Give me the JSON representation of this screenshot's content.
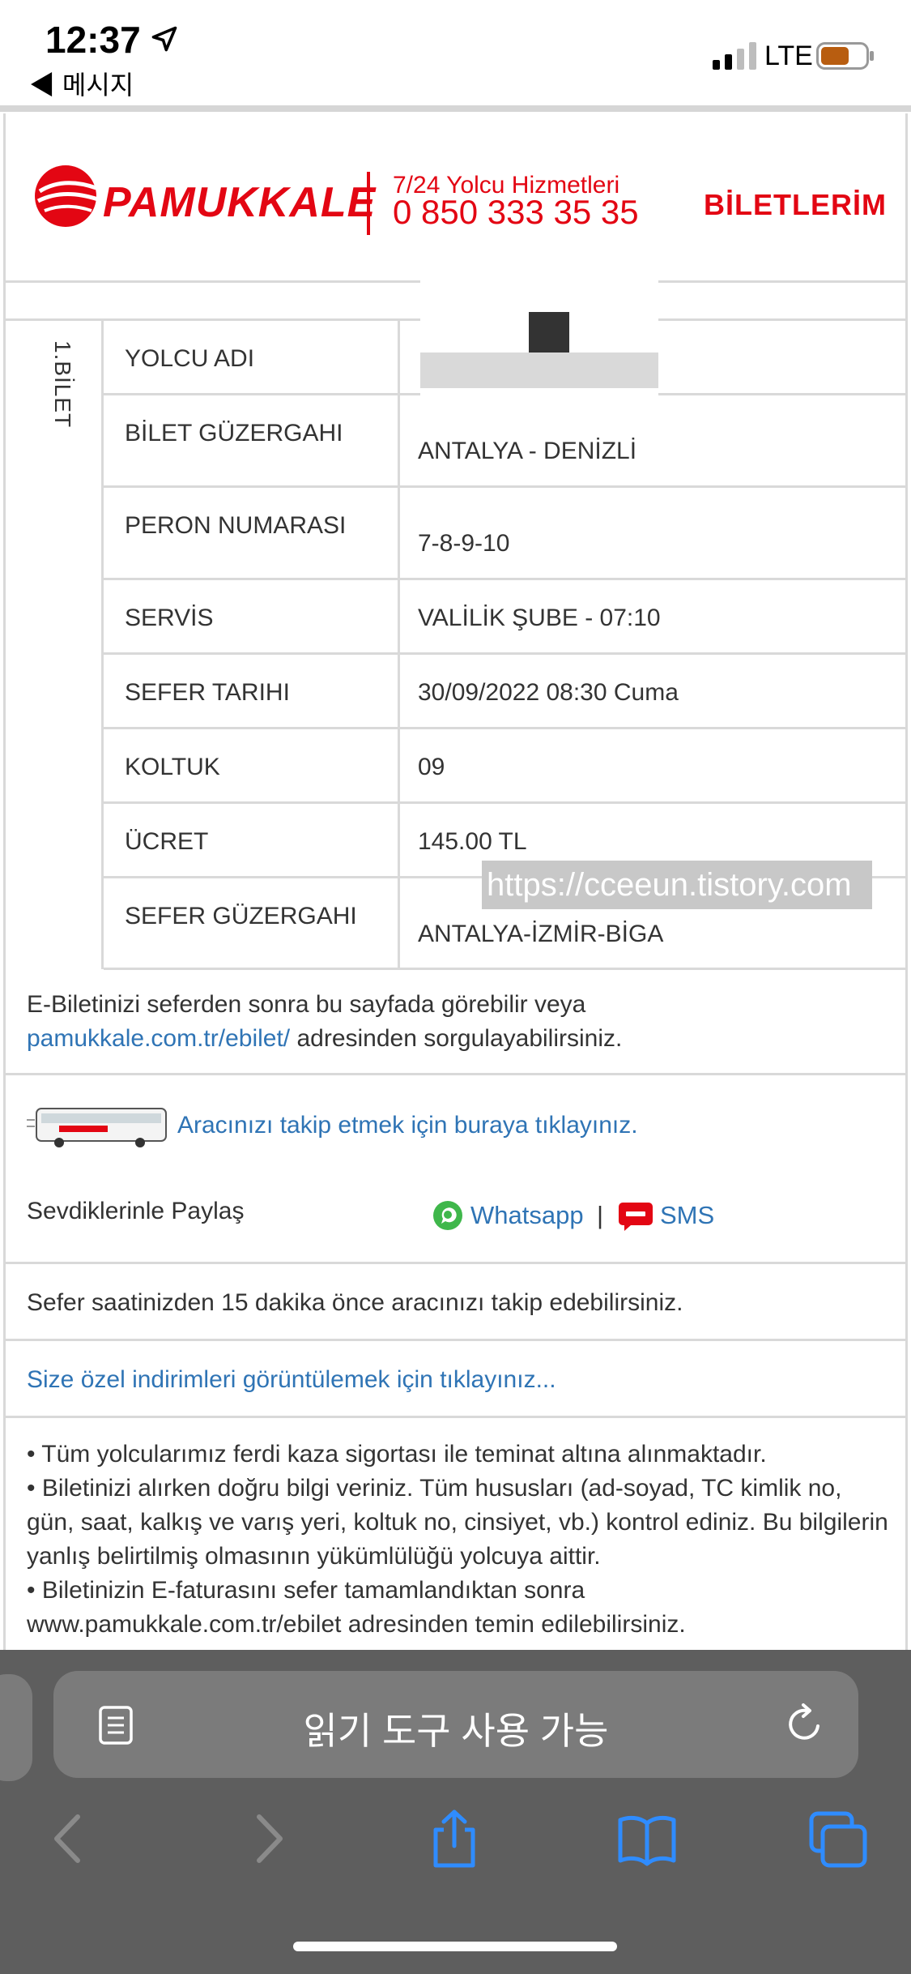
{
  "status_bar": {
    "time": "12:37",
    "back_label": "◀ 메시지",
    "network": "LTE"
  },
  "header": {
    "brand": "PAMUKKALE",
    "service_label": "7/24 Yolcu Hizmetleri",
    "service_phone": "0 850 333 35 35",
    "my_tickets": "BİLETLERİM"
  },
  "ticket": {
    "number_label": "1.BİLET",
    "rows": [
      {
        "label": "YOLCU ADI",
        "value": ""
      },
      {
        "label": "BİLET GÜZERGAHI",
        "value": "ANTALYA - DENİZLİ"
      },
      {
        "label": "PERON NUMARASI",
        "value": "7-8-9-10"
      },
      {
        "label": "SERVİS",
        "value": "VALİLİK ŞUBE - 07:10"
      },
      {
        "label": "SEFER TARIHI",
        "value": "30/09/2022 08:30 Cuma"
      },
      {
        "label": "KOLTUK",
        "value": "09"
      },
      {
        "label": "ÜCRET",
        "value": "145.00 TL"
      },
      {
        "label": "SEFER GÜZERGAHI",
        "value": "ANTALYA-İZMİR-BİGA"
      }
    ],
    "watermark": "https://cceeun.tistory.com"
  },
  "notes": {
    "ebilet_line1": "E-Biletinizi seferden sonra bu sayfada görebilir veya",
    "ebilet_link": "pamukkale.com.tr/ebilet/",
    "ebilet_line2_rest": " adresinden sorgulayabilirsiniz.",
    "track_link": "Aracınızı takip etmek için buraya tıklayınız.",
    "share_label": "Sevdiklerinle Paylaş",
    "whatsapp": "Whatsapp",
    "separator": "|",
    "sms": "SMS",
    "track_info": "Sefer saatinizden 15 dakika önce aracınızı takip edebilirsiniz.",
    "discount_link": "Size özel indirimleri görüntülemek için tıklayınız...",
    "bullets": [
      "• Tüm yolcularımız ferdi kaza sigortası ile teminat altına alınmaktadır.",
      "• Biletinizi alırken doğru bilgi veriniz. Tüm hususları (ad-soyad, TC kimlik no, gün, saat, kalkış ve varış yeri, koltuk no, cinsiyet, vb.) kontrol ediniz. Bu bilgilerin yanlış belirtilmiş olmasının yükümlülüğü yolcuya aittir.",
      "• Biletinizin E-faturasını sefer tamamlandıktan sonra www.pamukkale.com.tr/ebilet adresinden temin edilebilirsiniz."
    ]
  },
  "safari": {
    "address_text": "읽기 도구 사용 가능"
  },
  "colors": {
    "brand_red": "#e30613",
    "link_blue": "#2f74b5",
    "safari_bg": "#5e5e5e"
  }
}
